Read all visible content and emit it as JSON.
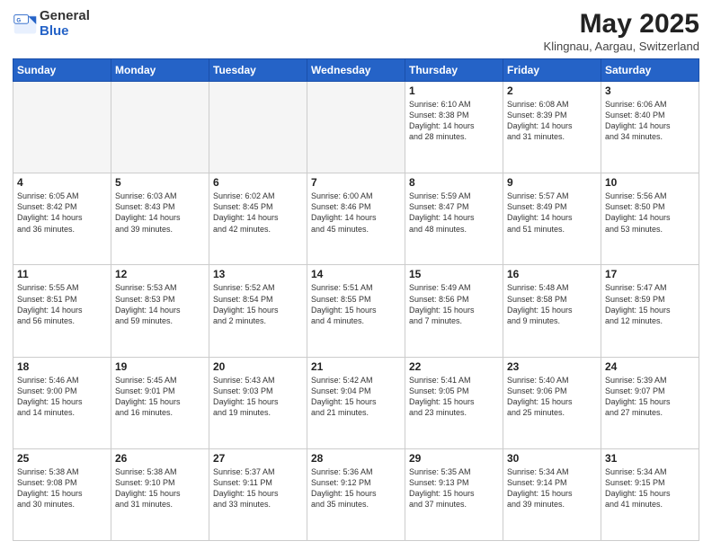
{
  "logo": {
    "general": "General",
    "blue": "Blue"
  },
  "header": {
    "month": "May 2025",
    "location": "Klingnau, Aargau, Switzerland"
  },
  "weekdays": [
    "Sunday",
    "Monday",
    "Tuesday",
    "Wednesday",
    "Thursday",
    "Friday",
    "Saturday"
  ],
  "weeks": [
    [
      {
        "day": "",
        "info": ""
      },
      {
        "day": "",
        "info": ""
      },
      {
        "day": "",
        "info": ""
      },
      {
        "day": "",
        "info": ""
      },
      {
        "day": "1",
        "info": "Sunrise: 6:10 AM\nSunset: 8:38 PM\nDaylight: 14 hours\nand 28 minutes."
      },
      {
        "day": "2",
        "info": "Sunrise: 6:08 AM\nSunset: 8:39 PM\nDaylight: 14 hours\nand 31 minutes."
      },
      {
        "day": "3",
        "info": "Sunrise: 6:06 AM\nSunset: 8:40 PM\nDaylight: 14 hours\nand 34 minutes."
      }
    ],
    [
      {
        "day": "4",
        "info": "Sunrise: 6:05 AM\nSunset: 8:42 PM\nDaylight: 14 hours\nand 36 minutes."
      },
      {
        "day": "5",
        "info": "Sunrise: 6:03 AM\nSunset: 8:43 PM\nDaylight: 14 hours\nand 39 minutes."
      },
      {
        "day": "6",
        "info": "Sunrise: 6:02 AM\nSunset: 8:45 PM\nDaylight: 14 hours\nand 42 minutes."
      },
      {
        "day": "7",
        "info": "Sunrise: 6:00 AM\nSunset: 8:46 PM\nDaylight: 14 hours\nand 45 minutes."
      },
      {
        "day": "8",
        "info": "Sunrise: 5:59 AM\nSunset: 8:47 PM\nDaylight: 14 hours\nand 48 minutes."
      },
      {
        "day": "9",
        "info": "Sunrise: 5:57 AM\nSunset: 8:49 PM\nDaylight: 14 hours\nand 51 minutes."
      },
      {
        "day": "10",
        "info": "Sunrise: 5:56 AM\nSunset: 8:50 PM\nDaylight: 14 hours\nand 53 minutes."
      }
    ],
    [
      {
        "day": "11",
        "info": "Sunrise: 5:55 AM\nSunset: 8:51 PM\nDaylight: 14 hours\nand 56 minutes."
      },
      {
        "day": "12",
        "info": "Sunrise: 5:53 AM\nSunset: 8:53 PM\nDaylight: 14 hours\nand 59 minutes."
      },
      {
        "day": "13",
        "info": "Sunrise: 5:52 AM\nSunset: 8:54 PM\nDaylight: 15 hours\nand 2 minutes."
      },
      {
        "day": "14",
        "info": "Sunrise: 5:51 AM\nSunset: 8:55 PM\nDaylight: 15 hours\nand 4 minutes."
      },
      {
        "day": "15",
        "info": "Sunrise: 5:49 AM\nSunset: 8:56 PM\nDaylight: 15 hours\nand 7 minutes."
      },
      {
        "day": "16",
        "info": "Sunrise: 5:48 AM\nSunset: 8:58 PM\nDaylight: 15 hours\nand 9 minutes."
      },
      {
        "day": "17",
        "info": "Sunrise: 5:47 AM\nSunset: 8:59 PM\nDaylight: 15 hours\nand 12 minutes."
      }
    ],
    [
      {
        "day": "18",
        "info": "Sunrise: 5:46 AM\nSunset: 9:00 PM\nDaylight: 15 hours\nand 14 minutes."
      },
      {
        "day": "19",
        "info": "Sunrise: 5:45 AM\nSunset: 9:01 PM\nDaylight: 15 hours\nand 16 minutes."
      },
      {
        "day": "20",
        "info": "Sunrise: 5:43 AM\nSunset: 9:03 PM\nDaylight: 15 hours\nand 19 minutes."
      },
      {
        "day": "21",
        "info": "Sunrise: 5:42 AM\nSunset: 9:04 PM\nDaylight: 15 hours\nand 21 minutes."
      },
      {
        "day": "22",
        "info": "Sunrise: 5:41 AM\nSunset: 9:05 PM\nDaylight: 15 hours\nand 23 minutes."
      },
      {
        "day": "23",
        "info": "Sunrise: 5:40 AM\nSunset: 9:06 PM\nDaylight: 15 hours\nand 25 minutes."
      },
      {
        "day": "24",
        "info": "Sunrise: 5:39 AM\nSunset: 9:07 PM\nDaylight: 15 hours\nand 27 minutes."
      }
    ],
    [
      {
        "day": "25",
        "info": "Sunrise: 5:38 AM\nSunset: 9:08 PM\nDaylight: 15 hours\nand 30 minutes."
      },
      {
        "day": "26",
        "info": "Sunrise: 5:38 AM\nSunset: 9:10 PM\nDaylight: 15 hours\nand 31 minutes."
      },
      {
        "day": "27",
        "info": "Sunrise: 5:37 AM\nSunset: 9:11 PM\nDaylight: 15 hours\nand 33 minutes."
      },
      {
        "day": "28",
        "info": "Sunrise: 5:36 AM\nSunset: 9:12 PM\nDaylight: 15 hours\nand 35 minutes."
      },
      {
        "day": "29",
        "info": "Sunrise: 5:35 AM\nSunset: 9:13 PM\nDaylight: 15 hours\nand 37 minutes."
      },
      {
        "day": "30",
        "info": "Sunrise: 5:34 AM\nSunset: 9:14 PM\nDaylight: 15 hours\nand 39 minutes."
      },
      {
        "day": "31",
        "info": "Sunrise: 5:34 AM\nSunset: 9:15 PM\nDaylight: 15 hours\nand 41 minutes."
      }
    ]
  ]
}
